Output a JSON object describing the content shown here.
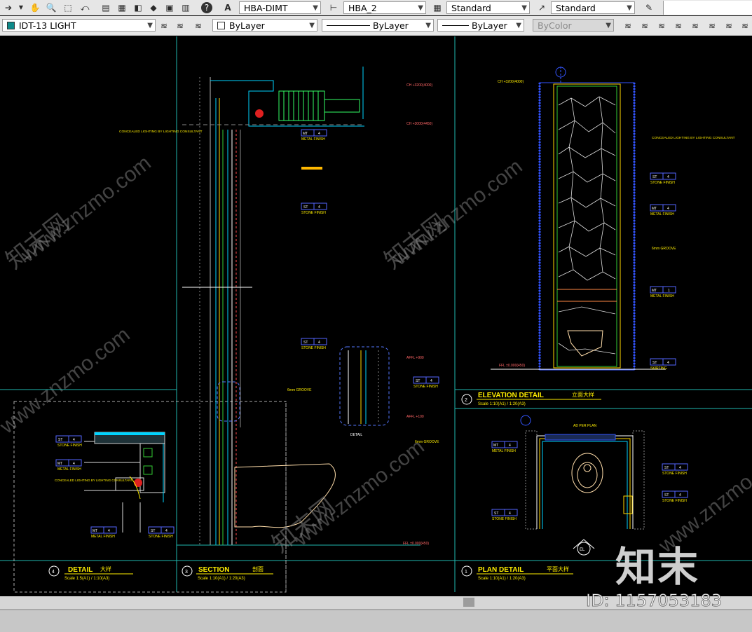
{
  "toolbar1": {
    "dimstyle": "HBA-DIMT",
    "mleaderstyle": "HBA_2",
    "tablestyle": "Standard",
    "textstyle": "Standard",
    "icons": [
      "arrow-icon",
      "pan-hand-icon",
      "zoom-realtime-icon",
      "zoom-window-icon",
      "zoom-previous-icon",
      "save-icon",
      "publish-icon",
      "plot-icon",
      "properties-icon",
      "calculator-icon",
      "help-icon",
      "text-style-icon",
      "dim-style-icon",
      "table-icon",
      "leader-icon"
    ]
  },
  "toolbar2": {
    "layer": "IDT-13 LIGHT",
    "color": "ByLayer",
    "linetype": "ByLayer",
    "lineweight": "ByLayer",
    "plotstyle": "ByColor"
  },
  "drawing": {
    "detail4": {
      "num": "4",
      "title": "DETAIL",
      "cn": "大样",
      "scale": "Scale 1:5(A1) / 1:10(A3)"
    },
    "section": {
      "num": "3",
      "title": "SECTION",
      "cn": "剖面",
      "scale": "Scale 1:10(A1) / 1:20(A3)"
    },
    "elevation": {
      "num": "2",
      "title": "ELEVATION   DETAIL",
      "cn": "立面大样",
      "scale": "Scale 1:10(A1) / 1:20(A3)"
    },
    "plan": {
      "num": "1",
      "title": "PLAN DETAIL",
      "cn": "平面大样",
      "scale": "Scale 1:10(A1) / 1:20(A3)"
    },
    "labels": {
      "stone": "STONE FINISH",
      "metal": "METAL FINISH",
      "concealed": "CONCEALED LIGHTING BY LIGHTING CONSULTANT",
      "ch1": "CH +3200(4000)",
      "ch2": "CH +3000(4450)",
      "ffl": "FFL ±0.000(450)",
      "afl1": "AFFL +900",
      "afl2": "AFFL +100",
      "groove": "6mm GROOVE",
      "st": "ST",
      "mt": "MT",
      "four": "4",
      "one": "1",
      "ad_per_plan": "AD PER PLAN",
      "el": "EL",
      "detail": "DETAIL",
      "skirting": "SKIRTING"
    }
  },
  "watermark": {
    "site": "www.znzmo.com",
    "cn": "知末网",
    "logo": "知末",
    "id": "ID: 1157053183"
  }
}
